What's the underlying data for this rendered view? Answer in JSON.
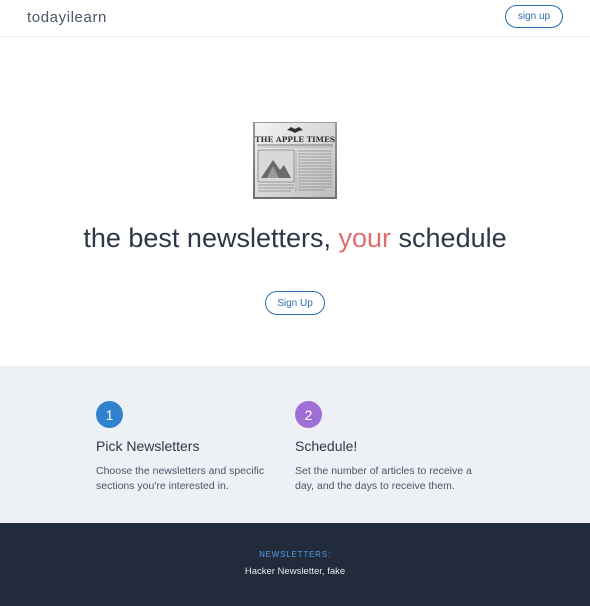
{
  "header": {
    "brand": "todayilearn",
    "signup_label": "sign up"
  },
  "hero": {
    "headline_before": "the best newsletters, ",
    "headline_accent": "your",
    "headline_after": " schedule",
    "signup_label": "Sign Up",
    "image": {
      "icon": "newspaper-icon",
      "masthead": "THE APPLE TIMES"
    }
  },
  "features": [
    {
      "number": "1",
      "title": "Pick Newsletters",
      "text": "Choose the newsletters and specific sections you're interested in.",
      "color": "#3182ce"
    },
    {
      "number": "2",
      "title": "Schedule!",
      "text": "Set the number of articles to receive a day, and the days to receive them.",
      "color": "#9f6ed6"
    }
  ],
  "footer": {
    "label": "NEWSLETTERS:",
    "text": "Hacker Newsletter, fake"
  },
  "colors": {
    "accent": "#e06c6c",
    "primary": "#2b6cb0",
    "features_bg": "#edf0f5",
    "footer_bg": "#222b3b"
  }
}
